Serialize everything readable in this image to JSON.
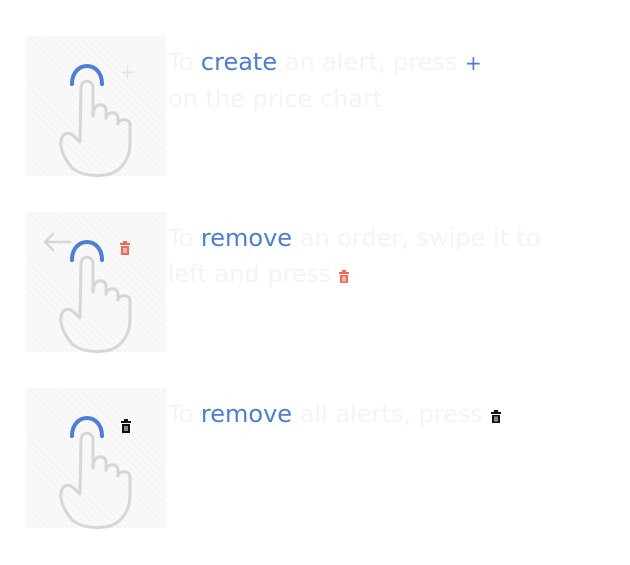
{
  "tips": [
    {
      "prefix": "To",
      "keyword": "create",
      "middle": "an alert, press",
      "plus_glyph": "+",
      "line2": "on the price chart",
      "hand_extra_icon": "plus-icon",
      "hand_plus_glyph": "+"
    },
    {
      "prefix": "To",
      "keyword": "remove",
      "line1_rest": "an order, swipe it to",
      "line2": "left and press",
      "hand_extra_icon": "red-trash-icon",
      "action_icon": "trash-icon"
    },
    {
      "prefix": "To",
      "keyword": "remove",
      "line1_rest": "all alerts, press",
      "hand_extra_icon": "black-trash-icon",
      "action_icon": "trash-icon"
    }
  ],
  "colors": {
    "accent": "#4a7ed9",
    "hand_outline": "#d6d6d6",
    "faded_text": "#f4f4f4",
    "trash_red": "#f26a57",
    "trash_black": "#111111"
  }
}
